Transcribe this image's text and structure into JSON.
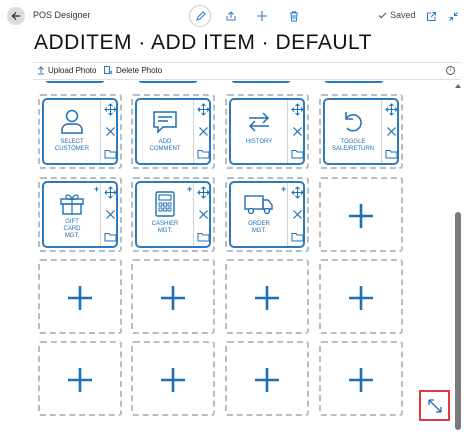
{
  "header": {
    "app_title": "POS Designer",
    "saved_label": "Saved",
    "page_title": "ADDITEM · ADD ITEM · DEFAULT"
  },
  "actions": {
    "upload_photo": "Upload Photo",
    "delete_photo": "Delete Photo"
  },
  "tiles": [
    {
      "label_line1": "SELECT",
      "label_line2": "CUSTOMER",
      "icon": "person-icon"
    },
    {
      "label_line1": "ADD",
      "label_line2": "COMMENT",
      "icon": "comment-icon"
    },
    {
      "label_line1": "HISTORY",
      "label_line2": "",
      "icon": "swap-arrows-icon"
    },
    {
      "label_line1": "TOGGLE",
      "label_line2": "SALE/RETURN",
      "icon": "undo-icon"
    },
    {
      "label_line1": "GIFT",
      "label_line2": "CARD",
      "label_line3": "MGT.",
      "icon": "gift-icon"
    },
    {
      "label_line1": "CASHIER",
      "label_line2": "MGT.",
      "icon": "calculator-icon"
    },
    {
      "label_line1": "ORDER",
      "label_line2": "MGT.",
      "icon": "truck-icon"
    }
  ],
  "colors": {
    "accent": "#2d7bbf",
    "dashed_border": "#b7bdc4",
    "highlight": "#e23a3a"
  }
}
